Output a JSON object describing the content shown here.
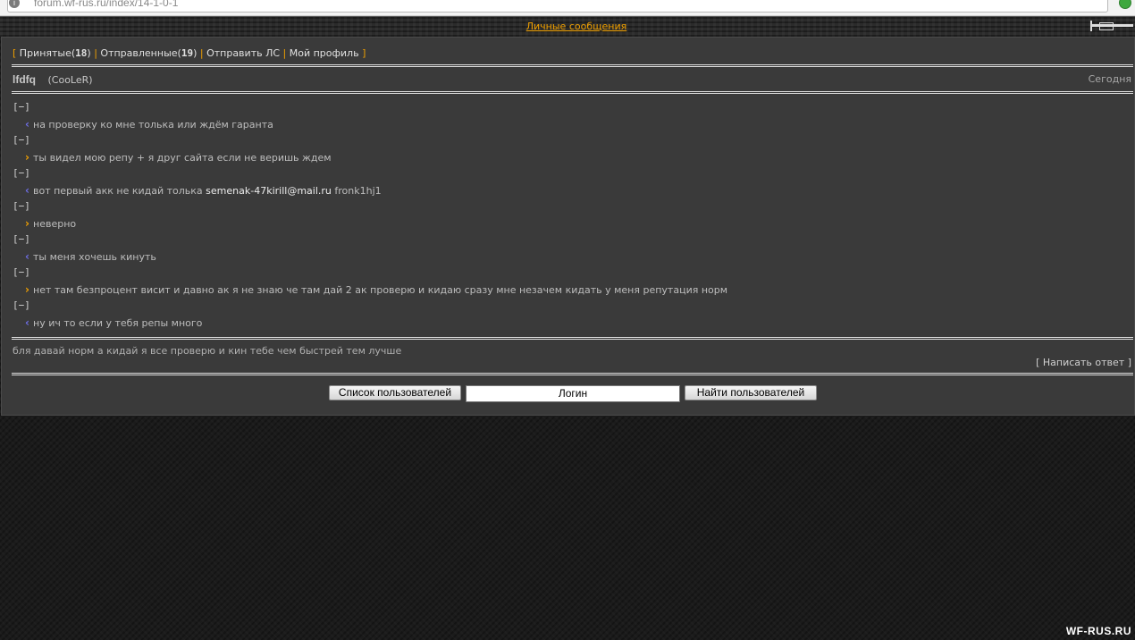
{
  "browser": {
    "url": "forum.wf-rus.ru/index/14-1-0-1"
  },
  "titlebar": {
    "link": "Личные сообщения"
  },
  "nav": {
    "received_label": "Принятые",
    "received_count": "18",
    "sent_label": "Отправленные",
    "sent_count": "19",
    "send_label": "Отправить ЛС",
    "profile_label": "Мой профиль"
  },
  "conversation": {
    "user": "lfdfq",
    "alias": "(CooLeR)",
    "date": "Сегодня",
    "toggle_label": "[−]",
    "messages": [
      {
        "dir": "in",
        "text": "на проверку ко мне толька или ждём гаранта"
      },
      {
        "dir": "out",
        "text": "ты видел мою репу + я друг сайта если не веришь ждем"
      },
      {
        "dir": "in",
        "text": "вот первый акк не кидай толька ",
        "email": "semenak-47kirill@mail.ru",
        "extra": " fronk1hj1"
      },
      {
        "dir": "out",
        "text": "неверно"
      },
      {
        "dir": "in",
        "text": "ты меня хочешь кинуть"
      },
      {
        "dir": "out",
        "text": "нет там безпроцент висит и давно ак я не знаю че там дай 2 ак проверю и кидаю сразу мне незачем кидать у меня репутация норм"
      },
      {
        "dir": "in",
        "text": "ну ич то если у тебя репы много"
      }
    ],
    "reply_text": "бля давай норм а кидай я все проверю и кин тебе чем быстрей тем лучше",
    "write_reply": "[ Написать ответ ]"
  },
  "search": {
    "list_button": "Список пользователей",
    "login_placeholder": "Логин",
    "find_button": "Найти пользователей"
  },
  "watermark": "WF-RUS.RU",
  "colors": {
    "accent": "#f0a000",
    "incoming_arrow": "#6e6ee6",
    "panel": "#3a3a3a"
  }
}
